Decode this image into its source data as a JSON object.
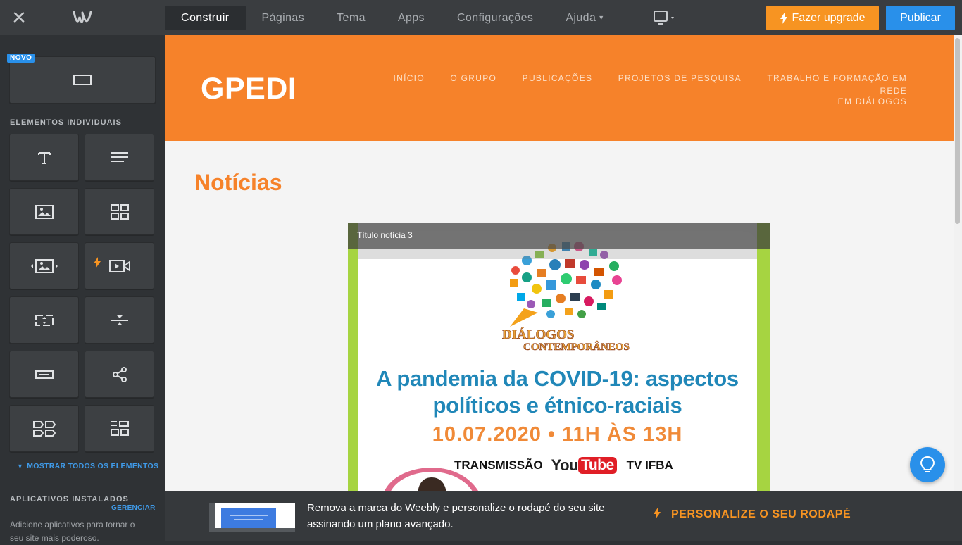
{
  "topbar": {
    "nav": [
      {
        "label": "Construir",
        "active": true
      },
      {
        "label": "Páginas"
      },
      {
        "label": "Tema"
      },
      {
        "label": "Apps"
      },
      {
        "label": "Configurações"
      },
      {
        "label": "Ajuda"
      }
    ],
    "upgrade_label": "Fazer upgrade",
    "publish_label": "Publicar"
  },
  "sidebar": {
    "new_badge": "NOVO",
    "section_individual": "ELEMENTOS INDIVIDUAIS",
    "show_all": "MOSTRAR TODOS OS ELEMENTOS",
    "section_apps": "APLICATIVOS INSTALADOS",
    "manage": "GERENCIAR",
    "apps_description": "Adicione aplicativos para tornar o seu site mais poderoso."
  },
  "site": {
    "logo": "GPEDI",
    "nav_row1": [
      "INÍCIO",
      "O GRUPO",
      "PUBLICAÇÕES",
      "PROJETOS DE PESQUISA",
      "TRABALHO E FORMAÇÃO EM REDE"
    ],
    "nav_row2": [
      "EM DIÁLOGOS"
    ],
    "page_heading": "Notícias",
    "slide": {
      "caption": "Título notícia 3",
      "logo_word1": "DIÁLOGOS",
      "logo_word2": "CONTEMPORÂNEOS",
      "title_line1": "A pandemia da COVID-19: aspectos",
      "title_line2": "políticos e étnico-raciais",
      "date": "10.07.2020 • 11H ÀS 13H",
      "transmission": "TRANSMISSÃO",
      "yt_you": "You",
      "yt_tube": "Tube",
      "channel": "TV IFBA"
    }
  },
  "footer": {
    "text": "Remova a marca do Weebly e personalize o rodapé do seu site assinando um plano avançado.",
    "cta": "PERSONALIZE O SEU RODAPÉ"
  },
  "colors": {
    "accent_orange": "#f6822a",
    "publish_blue": "#2990ea",
    "slide_green": "#a6d441"
  }
}
